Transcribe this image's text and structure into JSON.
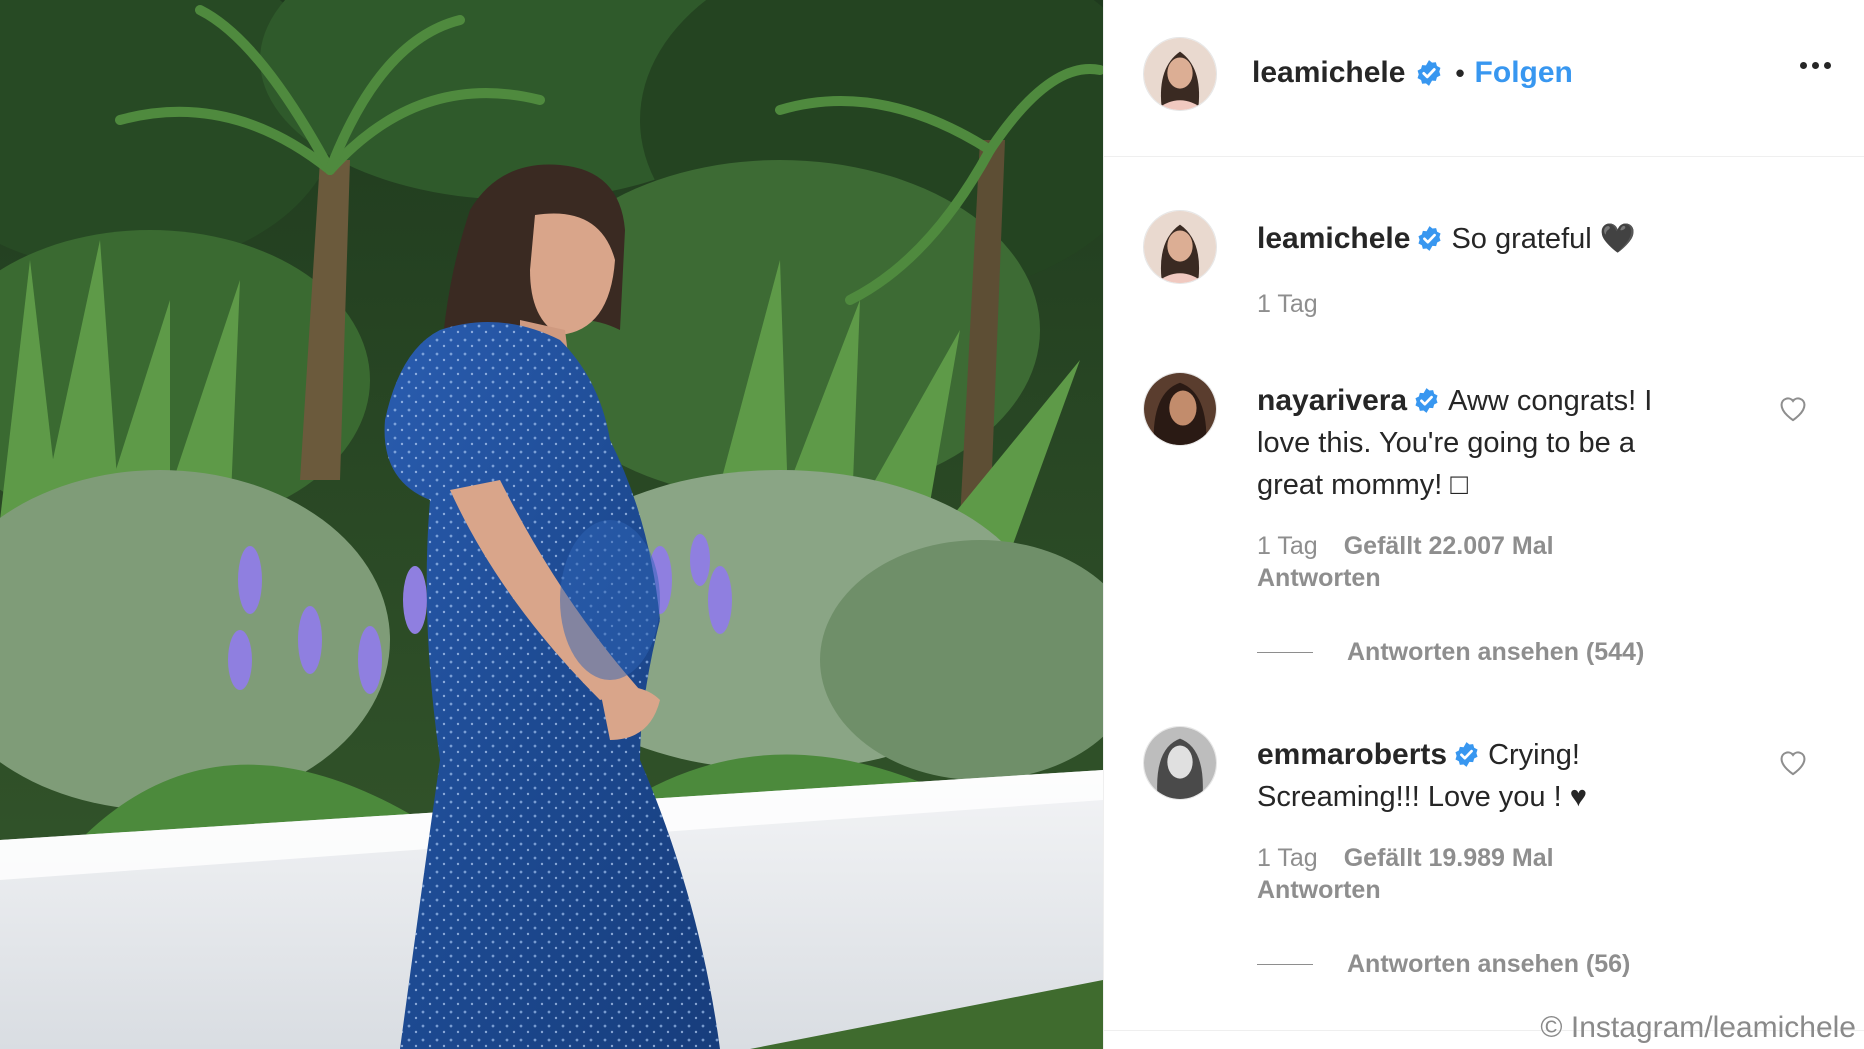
{
  "post": {
    "username": "leamichele",
    "separator": "•",
    "follow_label": "Folgen",
    "more_label": "more options"
  },
  "comments": [
    {
      "username": "leamichele",
      "text": "So grateful 🖤",
      "time": "1 Tag",
      "likes": "",
      "reply_label": "",
      "view_replies": ""
    },
    {
      "username": "nayarivera",
      "text": "Aww congrats! I love this. You're going to be a great mommy! □",
      "time": "1 Tag",
      "likes": "Gefällt 22.007 Mal",
      "reply_label": "Antworten",
      "view_replies": "Antworten ansehen (544)"
    },
    {
      "username": "emmaroberts",
      "text": "Crying! Screaming!!! Love you ! ♥",
      "time": "1 Tag",
      "likes": "Gefällt 19.989 Mal",
      "reply_label": "Antworten",
      "view_replies": "Antworten ansehen (56)"
    }
  ],
  "copyright": "© Instagram/leamichele",
  "colors": {
    "accent": "#3897f0",
    "text": "#262626",
    "muted": "#8e8e8e",
    "border": "#efefef",
    "dress": "#1f4f9a",
    "foliage": "#2f5a2b"
  }
}
